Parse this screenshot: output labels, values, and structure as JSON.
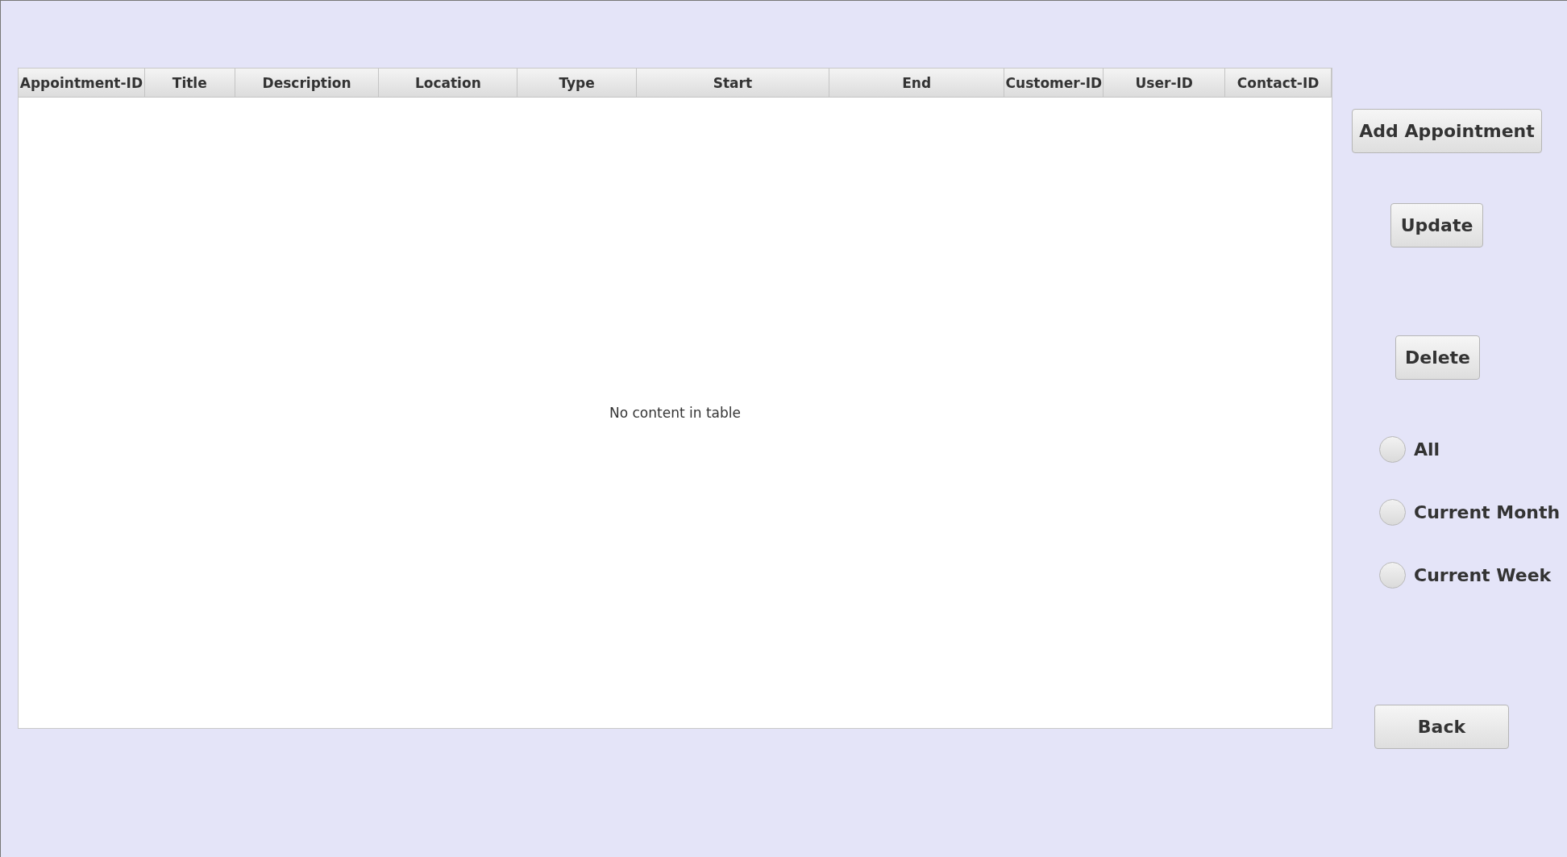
{
  "table": {
    "columns": [
      "Appointment-ID",
      "Title",
      "Description",
      "Location",
      "Type",
      "Start",
      "End",
      "Customer-ID",
      "User-ID",
      "Contact-ID"
    ],
    "empty_message": "No content in table"
  },
  "buttons": {
    "add": "Add Appointment",
    "update": "Update",
    "delete": "Delete",
    "back": "Back"
  },
  "filters": [
    {
      "label": "All",
      "selected": false
    },
    {
      "label": "Current Month",
      "selected": false
    },
    {
      "label": "Current Week",
      "selected": false
    }
  ]
}
